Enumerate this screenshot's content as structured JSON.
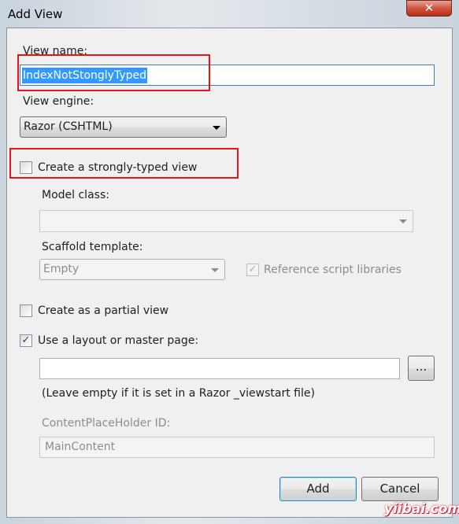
{
  "window": {
    "title": "Add View",
    "close_icon": "close-icon"
  },
  "view_name": {
    "label": "View name:",
    "value": "IndexNotStonglyTyped"
  },
  "view_engine": {
    "label": "View engine:",
    "selected": "Razor (CSHTML)"
  },
  "strongly_typed": {
    "label": "Create a strongly-typed view",
    "checked": false
  },
  "model_class": {
    "label": "Model class:",
    "value": ""
  },
  "scaffold": {
    "label": "Scaffold template:",
    "selected": "Empty"
  },
  "reference_scripts": {
    "label": "Reference script libraries",
    "checked": true,
    "check": "✓"
  },
  "partial_view": {
    "label": "Create as a partial view",
    "checked": false
  },
  "layout": {
    "label": "Use a layout or master page:",
    "checked": true,
    "check": "✓",
    "value": "",
    "browse_label": "...",
    "hint": "(Leave empty if it is set in a Razor _viewstart file)"
  },
  "content_placeholder": {
    "label": "ContentPlaceHolder ID:",
    "value": "MainContent"
  },
  "buttons": {
    "add": "Add",
    "cancel": "Cancel"
  },
  "watermark": "yiibai.com",
  "colors": {
    "highlight": "#e8141a",
    "selection": "#3399ff"
  }
}
